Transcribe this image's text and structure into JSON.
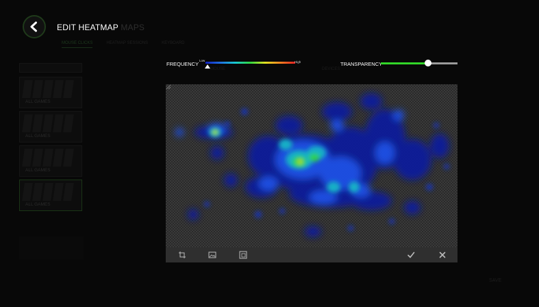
{
  "header": {
    "title_main": "EDIT HEATMAP",
    "title_faded": "MAPS",
    "subtabs": [
      "MOUSE CLICKS",
      "HEATMAP SESSIONS",
      "KEYBOARD"
    ]
  },
  "left_list": {
    "items": [
      {
        "label": "ALL GAMES",
        "selected": false
      },
      {
        "label": "ALL GAMES",
        "selected": false
      },
      {
        "label": "ALL GAMES",
        "selected": false
      },
      {
        "label": "ALL GAMES",
        "selected": true
      }
    ]
  },
  "controls": {
    "frequency_label": "FREQUENCY",
    "frequency_low": "Low",
    "frequency_high": "High",
    "frequency_value": 0.02,
    "transparency_label": "TRANSPARENCY",
    "transparency_value": 0.62,
    "devices_label": "DEVICES",
    "left_label": "MOUSE"
  },
  "footer": {
    "save_label": "SAVE"
  },
  "colors": {
    "accent": "#32d628",
    "background": "#000000",
    "toolbar": "#2f2f2f"
  },
  "toolbar": {
    "icons": [
      "crop-icon",
      "image-icon",
      "resize-icon",
      "check-icon",
      "close-icon"
    ]
  }
}
